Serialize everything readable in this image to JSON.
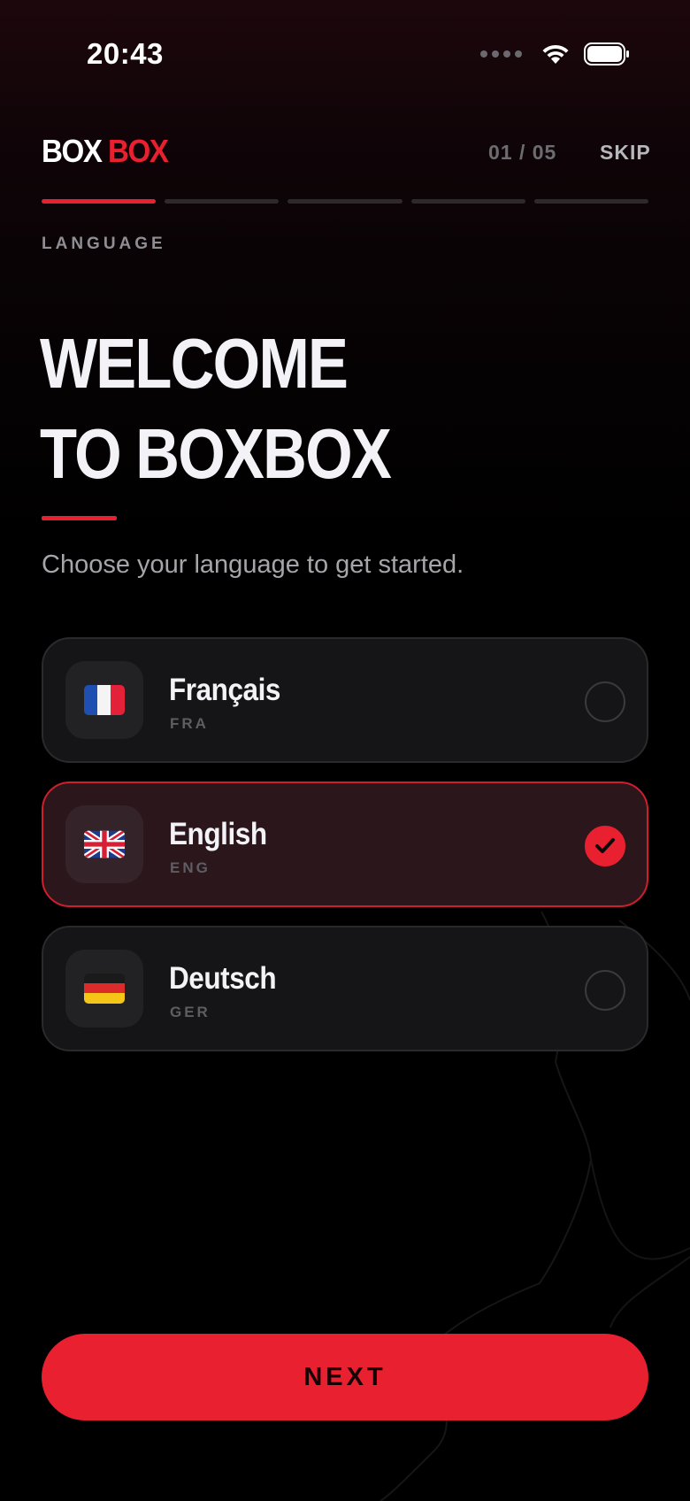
{
  "status_bar": {
    "time": "20:43"
  },
  "header": {
    "brand_part1": "BOX",
    "brand_part2": "BOX",
    "step_counter": "01 / 05",
    "skip_label": "SKIP",
    "progress": {
      "current_step": 1,
      "total_steps": 5
    }
  },
  "section_label": "LANGUAGE",
  "headline": {
    "line1": "WELCOME",
    "line2": "TO BOXBOX"
  },
  "subtitle": "Choose your language to get started.",
  "languages": [
    {
      "name": "Français",
      "code": "FRA",
      "flag": "france-flag-icon",
      "selected": false
    },
    {
      "name": "English",
      "code": "ENG",
      "flag": "uk-flag-icon",
      "selected": true
    },
    {
      "name": "Deutsch",
      "code": "GER",
      "flag": "germany-flag-icon",
      "selected": false
    }
  ],
  "next_button": {
    "label": "NEXT"
  },
  "colors": {
    "accent": "#e8202f",
    "background": "#000000",
    "card": "#151517",
    "card_selected": "#2a161b"
  }
}
